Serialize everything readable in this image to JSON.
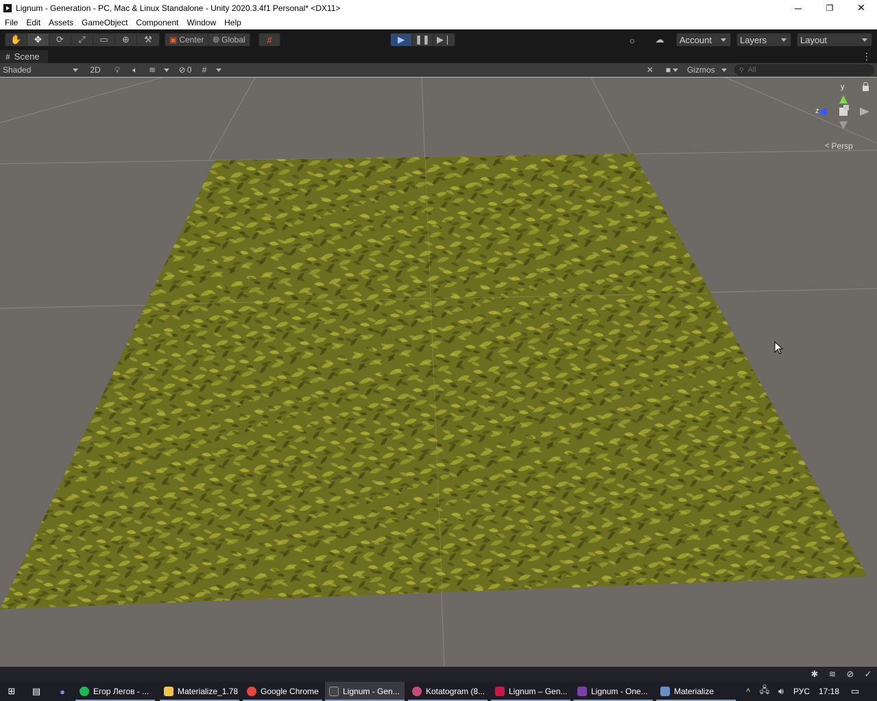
{
  "window": {
    "title": "Lignum - Generation - PC, Mac & Linux Standalone - Unity 2020.3.4f1 Personal* <DX11>",
    "minimize": "─",
    "restore": "❐",
    "close": "✕"
  },
  "menu": [
    "File",
    "Edit",
    "Assets",
    "GameObject",
    "Component",
    "Window",
    "Help"
  ],
  "toolbar": {
    "tools": [
      "hand-tool-icon",
      "move-tool-icon",
      "rotate-tool-icon",
      "scale-tool-icon",
      "rect-tool-icon",
      "transform-tool-icon",
      "custom-tool-icon"
    ],
    "pivot_mode": "Center",
    "pivot_rotation": "Global",
    "play_state": "playing",
    "account_label": "Account",
    "layers_label": "Layers",
    "layout_label": "Layout"
  },
  "scene_tab": {
    "label": "Scene"
  },
  "scene_toolbar": {
    "draw_mode": "Shaded",
    "mode_2d": "2D",
    "hidden_count": "0",
    "gizmos_label": "Gizmos",
    "search_placeholder": "All"
  },
  "gizmo": {
    "y_label": "y",
    "z_label": "z",
    "projection": "Persp"
  },
  "colors": {
    "editor_dark": "#191919",
    "viewport_bg": "#6d6964",
    "play_active": "#2f4c78",
    "ground_texture": "#6e7220"
  },
  "taskbar": {
    "apps": [
      {
        "label": "Егор Легов - ...",
        "icon": "spotify-icon",
        "color": "#1db954"
      },
      {
        "label": "Materialize_1.78",
        "icon": "folder-icon",
        "color": "#f0c54a"
      },
      {
        "label": "Google Chrome",
        "icon": "chrome-icon",
        "color": "#e8453c"
      },
      {
        "label": "Lignum - Gen...",
        "icon": "unity-icon",
        "color": "#444444"
      },
      {
        "label": "Kotatogram (8...",
        "icon": "kotatogram-icon",
        "color": "#c64b7a"
      },
      {
        "label": "Lignum – Gen...",
        "icon": "rider-icon",
        "color": "#c21b4a"
      },
      {
        "label": "Lignum - One...",
        "icon": "onenote-icon",
        "color": "#7b3fa8"
      },
      {
        "label": "Materialize",
        "icon": "materialize-icon",
        "color": "#6a8ec8"
      }
    ],
    "language": "РУС",
    "time": "17:18"
  }
}
